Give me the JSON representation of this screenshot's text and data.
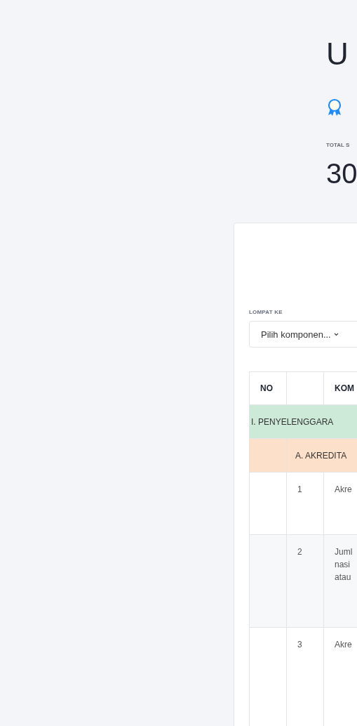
{
  "title": "U",
  "total": {
    "label": "TOTAL S",
    "value": "30"
  },
  "jump": {
    "label": "LOMPAT KE",
    "value": "Pilih komponen..."
  },
  "table": {
    "columns": [
      {
        "kind": "no",
        "label": "NO"
      },
      {
        "kind": "blank"
      },
      {
        "kind": "component",
        "label": "KOM"
      }
    ],
    "rows": [
      {
        "kind": "section",
        "label": "I. PENYELENGGARA"
      },
      {
        "kind": "subsection",
        "label": "A. AKREDITA"
      },
      {
        "kind": "item",
        "number": "1",
        "lines": [
          "Akre"
        ]
      },
      {
        "kind": "item",
        "number": "2",
        "lines": [
          "Juml",
          "nasi",
          "atau"
        ]
      },
      {
        "kind": "item",
        "number": "3",
        "lines": [
          "Akre"
        ]
      }
    ]
  }
}
